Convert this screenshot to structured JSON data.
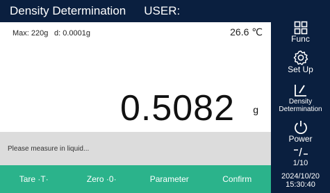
{
  "header": {
    "title": "Density Determination",
    "user_label": "USER:"
  },
  "status": {
    "max": "Max: 220g",
    "d": "d: 0.0001g",
    "temperature": "26.6 ℃"
  },
  "reading": {
    "value": "0.5082",
    "unit": "g"
  },
  "message": "Please measure in liquid...",
  "softkeys": [
    {
      "label": "Tare ·T·"
    },
    {
      "label": "Zero ·0·"
    },
    {
      "label": "Parameter"
    },
    {
      "label": "Confirm"
    }
  ],
  "sidebar": {
    "func_label": "Func",
    "setup_label": "Set Up",
    "density_label_1": "Density",
    "density_label_2": "Determination",
    "power_label": "Power",
    "page_indicator": "1/10",
    "date": "2024/10/20",
    "time": "15:30:40"
  }
}
